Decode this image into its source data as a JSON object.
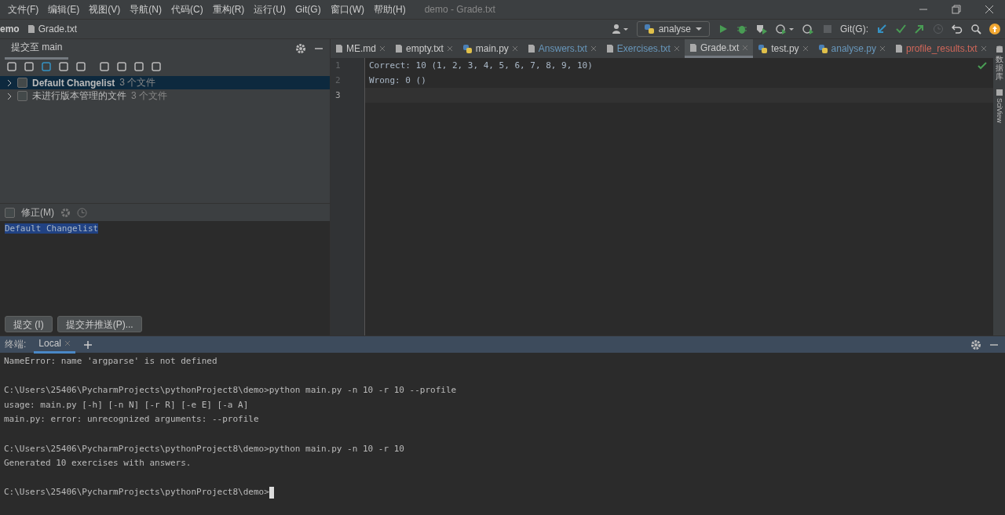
{
  "menu": [
    "文件(F)",
    "编辑(E)",
    "视图(V)",
    "导航(N)",
    "代码(C)",
    "重构(R)",
    "运行(U)",
    "Git(G)",
    "窗口(W)",
    "帮助(H)"
  ],
  "window": {
    "title": "demo - Grade.txt"
  },
  "breadcrumb": [
    "emo",
    "Grade.txt"
  ],
  "run_config": {
    "label": "analyse"
  },
  "git_label": "Git(G):",
  "commit_panel": {
    "tab": {
      "label": "提交至 main",
      "selected": true
    },
    "changelists": [
      {
        "label": "Default Changelist",
        "count": "3 个文件",
        "bold": true,
        "selected": true,
        "checked": false
      },
      {
        "label": "未进行版本管理的文件",
        "count": "3 个文件",
        "bold": false,
        "selected": false,
        "checked": false
      }
    ],
    "amend": {
      "label": "修正(M)",
      "checked": false
    },
    "message": "Default Changelist",
    "buttons": [
      "提交 (I)",
      "提交并推送(P)..."
    ]
  },
  "editor_tabs": [
    {
      "label": "ME.md",
      "kind": "text",
      "color": "#cccccc",
      "selected": false
    },
    {
      "label": "empty.txt",
      "kind": "text",
      "color": "#cccccc",
      "selected": false
    },
    {
      "label": "main.py",
      "kind": "python",
      "color": "#cccccc",
      "selected": false
    },
    {
      "label": "Answers.txt",
      "kind": "text",
      "color": "#6897bb",
      "selected": false
    },
    {
      "label": "Exercises.txt",
      "kind": "text",
      "color": "#6897bb",
      "selected": false
    },
    {
      "label": "Grade.txt",
      "kind": "text",
      "color": "#cccccc",
      "selected": true
    },
    {
      "label": "test.py",
      "kind": "python",
      "color": "#cccccc",
      "selected": false
    },
    {
      "label": "analyse.py",
      "kind": "python",
      "color": "#6897bb",
      "selected": false
    },
    {
      "label": "profile_results.txt",
      "kind": "text",
      "color": "#d1675a",
      "selected": false
    }
  ],
  "editor_lines": [
    {
      "number": "1",
      "text": "Correct: 10 (1, 2, 3, 4, 5, 6, 7, 8, 9, 10)",
      "current": false
    },
    {
      "number": "2",
      "text": "Wrong: 0 ()",
      "current": false
    },
    {
      "number": "3",
      "current": true
    }
  ],
  "right_strip": [
    "数据库",
    "SciView"
  ],
  "terminal": {
    "label": "终端:",
    "tabs": [
      {
        "label": "Local",
        "selected": true
      }
    ],
    "lines": [
      {
        "kind": "text",
        "text": "NameError: name 'argparse' is not defined",
        "cursor": false
      },
      {
        "kind": "blank"
      },
      {
        "kind": "text",
        "text": "C:\\Users\\25406\\PycharmProjects\\pythonProject8\\demo>python main.py -n 10 -r 10 --profile",
        "cursor": false
      },
      {
        "kind": "text",
        "text": "usage: main.py [-h] [-n N] [-r R] [-e E] [-a A]",
        "cursor": false
      },
      {
        "kind": "text",
        "text": "main.py: error: unrecognized arguments: --profile",
        "cursor": false
      },
      {
        "kind": "blank"
      },
      {
        "kind": "text",
        "text": "C:\\Users\\25406\\PycharmProjects\\pythonProject8\\demo>python main.py -n 10 -r 10",
        "cursor": false
      },
      {
        "kind": "text",
        "text": "Generated 10 exercises with answers.",
        "cursor": false
      },
      {
        "kind": "blank"
      },
      {
        "kind": "text",
        "text": "C:\\Users\\25406\\PycharmProjects\\pythonProject8\\demo>",
        "cursor": true
      }
    ]
  }
}
